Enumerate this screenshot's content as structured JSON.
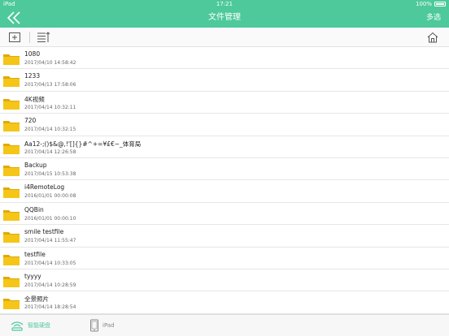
{
  "status_bar": {
    "device": "iPad",
    "time": "17:21",
    "battery": "100%"
  },
  "nav": {
    "title": "文件管理",
    "multi_select": "多选"
  },
  "files": [
    {
      "name": "1080",
      "date": "2017/04/10 14:58:42"
    },
    {
      "name": "1233",
      "date": "2017/04/13 17:58:06"
    },
    {
      "name": "4K视频",
      "date": "2017/04/14 10:32:11"
    },
    {
      "name": "720",
      "date": "2017/04/14 10:32:15"
    },
    {
      "name": "Aa12-;()$&@,!'[]{}#^+=¥£€~_体育局",
      "date": "2017/04/14 12:26:58"
    },
    {
      "name": "Backup",
      "date": "2017/04/15 10:53:38"
    },
    {
      "name": "i4RemoteLog",
      "date": "2016/01/01 00:00:08"
    },
    {
      "name": "QQBin",
      "date": "2016/01/01 00:00:10"
    },
    {
      "name": "smile testfile",
      "date": "2017/04/14 11:55:47"
    },
    {
      "name": "testfile",
      "date": "2017/04/14 10:33:05"
    },
    {
      "name": "tyyyy",
      "date": "2017/04/14 10:28:59"
    },
    {
      "name": "全景照片",
      "date": "2017/04/14 18:28:54"
    }
  ],
  "tabs": [
    {
      "label": "智能硬盘",
      "icon": "wifi-disk-icon",
      "active": true
    },
    {
      "label": "iPad",
      "icon": "ipad-icon",
      "active": false
    }
  ],
  "colors": {
    "accent": "#4dc99b",
    "folder": "#f5c518",
    "folder_dark": "#e0a90a"
  }
}
